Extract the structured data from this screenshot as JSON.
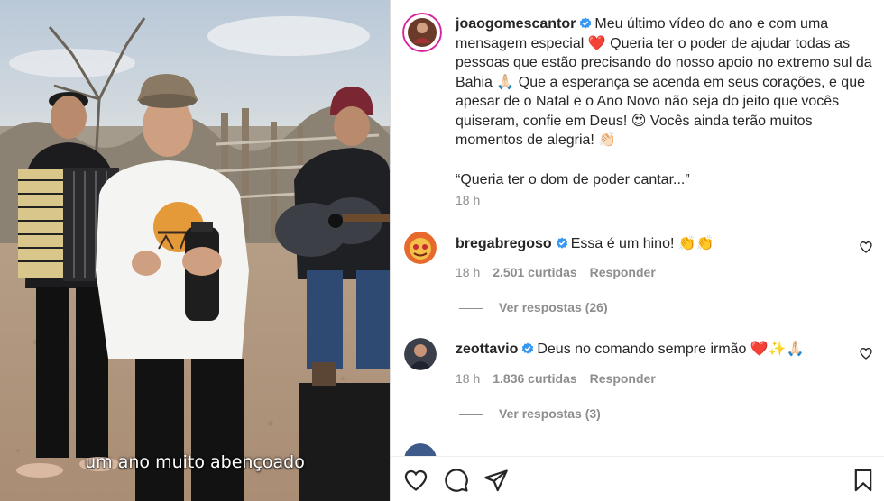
{
  "post": {
    "username": "joaogomescantor",
    "caption_p1": "Meu último vídeo do ano e com uma mensagem especial",
    "caption_p2": "Queria ter o poder de ajudar todas as pessoas que estão precisando do nosso apoio no extremo sul da Bahia",
    "caption_p3": "Que a esperança se acenda em seus corações, e que apesar de o Natal e o Ano Novo não seja do jeito que vocês quiseram, confie em Deus!",
    "caption_p4": "Vocês ainda terão muitos momentos de alegria!",
    "quote": "“Queria ter o dom de poder cantar...”",
    "time": "18 h",
    "emoji_heart": "❤️",
    "emoji_pray": "🙏🏻",
    "emoji_hearteyes": "😍",
    "emoji_clap": "👏🏻"
  },
  "video": {
    "subtitle": "um ano muito abençoado"
  },
  "comments": [
    {
      "username": "bregabregoso",
      "text": "Essa é um hino!",
      "emojis": "👏👏",
      "time": "18 h",
      "likes": "2.501 curtidas",
      "reply": "Responder",
      "view_replies": "Ver respostas (26)"
    },
    {
      "username": "zeottavio",
      "text": "Deus no comando sempre irmão",
      "emojis": "❤️✨🙏🏻",
      "time": "18 h",
      "likes": "1.836 curtidas",
      "reply": "Responder",
      "view_replies": "Ver respostas (3)"
    }
  ],
  "icons": {
    "like": "heart-icon",
    "comment": "comment-icon",
    "share": "share-icon",
    "save": "bookmark-icon",
    "verified": "verified-badge-icon"
  },
  "colors": {
    "verified": "#3897f0",
    "text": "#262626",
    "secondary": "#8e8e8e",
    "heart": "#ed4956"
  }
}
